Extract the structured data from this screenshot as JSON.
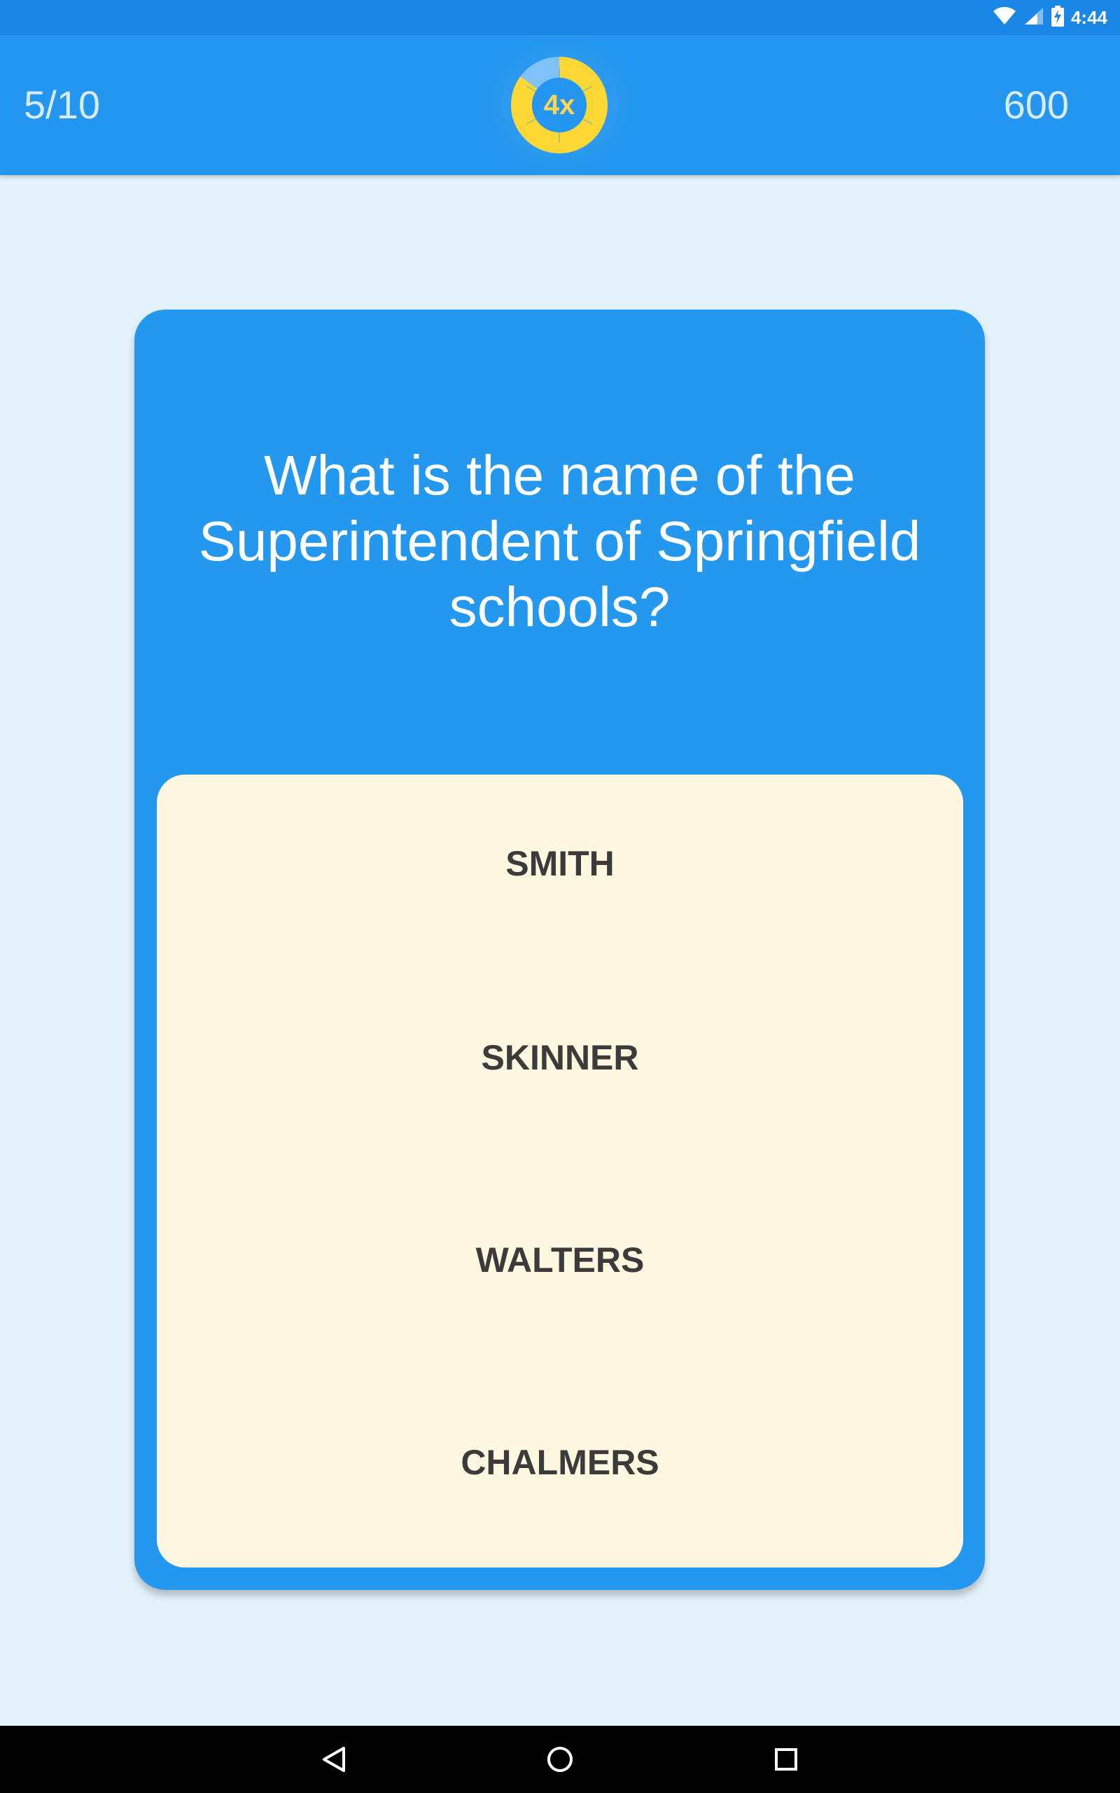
{
  "status_bar": {
    "time": "4:44",
    "icons": [
      "wifi-icon",
      "cell-signal-icon",
      "battery-charging-icon"
    ]
  },
  "header": {
    "progress": "5/10",
    "multiplier": "4x",
    "multiplier_timer_fraction": 0.85,
    "score": "600"
  },
  "question": {
    "text": "What is the name of the Superintendent of Springfield schools?"
  },
  "answers": [
    "SMITH",
    "SKINNER",
    "WALTERS",
    "CHALMERS"
  ],
  "nav_bar": {
    "icons": [
      "back-icon",
      "home-icon",
      "recents-icon"
    ]
  },
  "colors": {
    "primary": "#2496ef",
    "status_bar": "#1a87e6",
    "background": "#e3f1fb",
    "answer_panel": "#fff8e1",
    "multiplier_accent": "#ffd54f"
  }
}
